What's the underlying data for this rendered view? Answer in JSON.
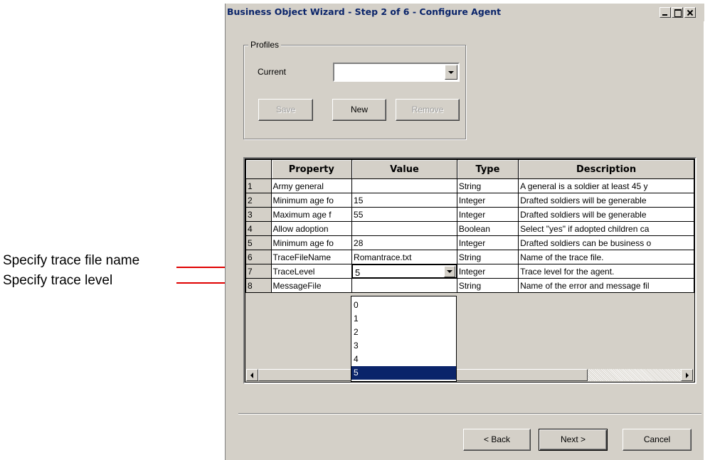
{
  "annotations": [
    {
      "text": "Specify trace file name",
      "color": "#e00000"
    },
    {
      "text": "Specify trace level",
      "color": "#e00000"
    }
  ],
  "window": {
    "title": "Business Object Wizard - Step 2 of 6 - Configure Agent"
  },
  "profiles": {
    "legend": "Profiles",
    "current_label": "Current",
    "current_value": "",
    "save_label": "Save",
    "new_label": "New",
    "remove_label": "Remove"
  },
  "grid": {
    "columns": [
      "",
      "Property",
      "Value",
      "Type",
      "Description"
    ],
    "rows": [
      {
        "num": "1",
        "property": "Army general",
        "value": "",
        "type": "String",
        "description": "A general is a soldier at least 45 y"
      },
      {
        "num": "2",
        "property": "Minimum age fo",
        "value": "15",
        "type": "Integer",
        "description": "Drafted soldiers will be generable"
      },
      {
        "num": "3",
        "property": "Maximum age f",
        "value": "55",
        "type": "Integer",
        "description": "Drafted soldiers will be generable"
      },
      {
        "num": "4",
        "property": "Allow adoption",
        "value": "",
        "type": "Boolean",
        "description": "Select \"yes\" if adopted children ca"
      },
      {
        "num": "5",
        "property": "Minimum age fo",
        "value": "28",
        "type": "Integer",
        "description": "Drafted soldiers can be business o"
      },
      {
        "num": "6",
        "property": "TraceFileName",
        "value": "Romantrace.txt",
        "type": "String",
        "description": "Name of the trace file."
      },
      {
        "num": "7",
        "property": "TraceLevel",
        "value": "5",
        "type": "Integer",
        "description": "Trace level for the agent."
      },
      {
        "num": "8",
        "property": "MessageFile",
        "value": "",
        "type": "String",
        "description": "Name of the error and message fil"
      }
    ],
    "dropdown_options": [
      "0",
      "1",
      "2",
      "3",
      "4",
      "5"
    ],
    "dropdown_selected": "5"
  },
  "footer": {
    "back_label": "< Back",
    "next_label": "Next >",
    "cancel_label": "Cancel"
  },
  "colors": {
    "dialog_bg": "#d4d0c8",
    "title_text": "#0a246a",
    "selection": "#0a246a",
    "arrow": "#e00000"
  }
}
